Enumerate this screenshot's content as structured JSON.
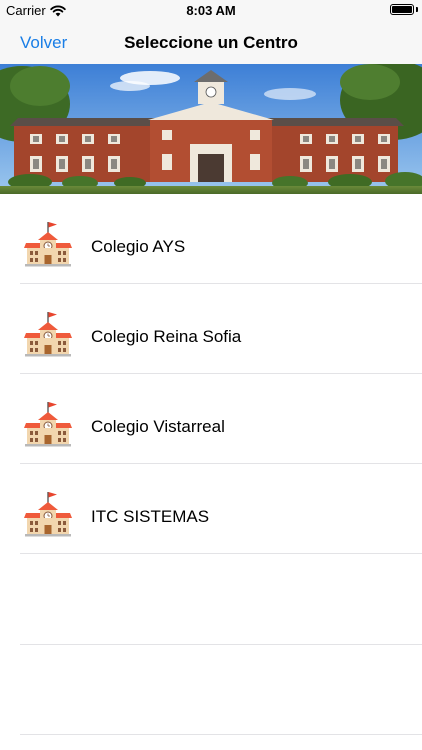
{
  "status_bar": {
    "carrier": "Carrier",
    "time": "8:03 AM",
    "wifi_icon": "wifi-icon",
    "battery_icon": "battery-icon"
  },
  "nav": {
    "back_label": "Volver",
    "title": "Seleccione un Centro"
  },
  "banner": {
    "image": "school-building-photo"
  },
  "centers": [
    {
      "label": "Colegio AYS",
      "icon": "school-icon"
    },
    {
      "label": "Colegio Reina Sofia",
      "icon": "school-icon"
    },
    {
      "label": "Colegio Vistarreal",
      "icon": "school-icon"
    },
    {
      "label": "ITC SISTEMAS",
      "icon": "school-icon"
    }
  ],
  "colors": {
    "accent": "#1a7ee6",
    "nav_background": "#f7f7f7",
    "separator": "#e3e3e6"
  }
}
